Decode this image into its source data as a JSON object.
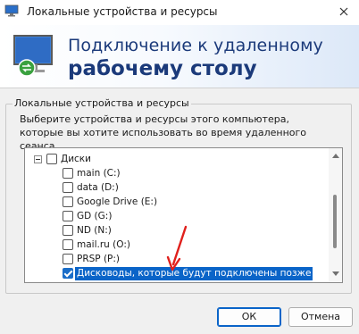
{
  "window": {
    "title": "Локальные устройства и ресурсы",
    "close_icon": "close-icon"
  },
  "banner": {
    "line1": "Подключение к удаленному",
    "line2": "рабочему столу",
    "icon": "remote-desktop-icon"
  },
  "group": {
    "label": "Локальные устройства и ресурсы",
    "description": "Выберите устройства и ресурсы этого компьютера, которые вы хотите использовать во время удаленного сеанса."
  },
  "tree": {
    "root": {
      "label": "Диски",
      "checked": false,
      "expanded": true
    },
    "items": [
      {
        "label": "main (C:)",
        "checked": false,
        "selected": false
      },
      {
        "label": "data (D:)",
        "checked": false,
        "selected": false
      },
      {
        "label": "Google Drive (E:)",
        "checked": false,
        "selected": false
      },
      {
        "label": "GD (G:)",
        "checked": false,
        "selected": false
      },
      {
        "label": "ND (N:)",
        "checked": false,
        "selected": false
      },
      {
        "label": "mail.ru (O:)",
        "checked": false,
        "selected": false
      },
      {
        "label": "PRSP (P:)",
        "checked": false,
        "selected": false
      },
      {
        "label": "Дисководы, которые будут подключены позже",
        "checked": true,
        "selected": true
      }
    ]
  },
  "buttons": {
    "ok": "ОК",
    "cancel": "Отмена"
  },
  "colors": {
    "accent": "#0a64c8",
    "banner_text": "#1b3a7a",
    "annotation": "#e0201c"
  }
}
